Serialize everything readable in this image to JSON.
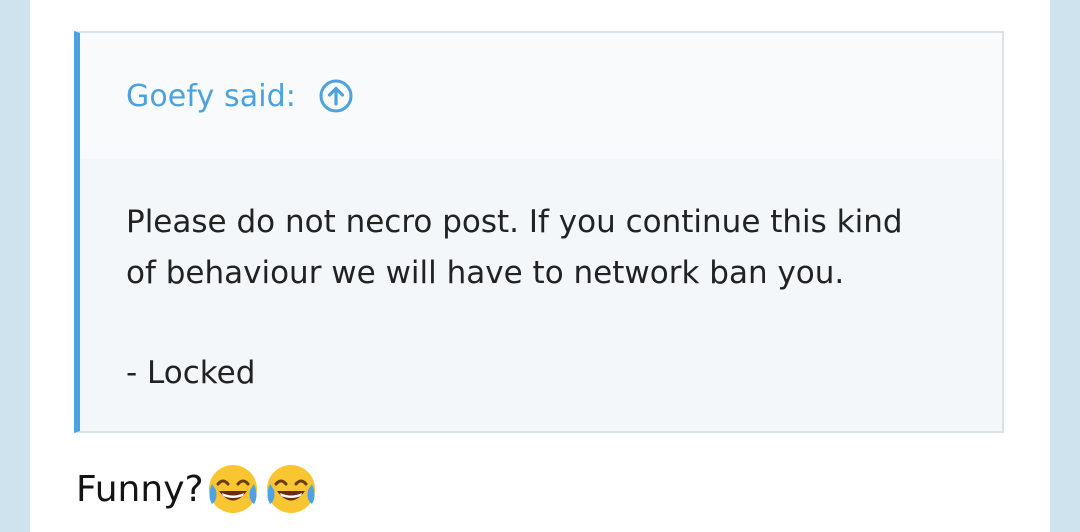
{
  "quote": {
    "author_label": "Goefy said:",
    "jump_icon": "arrow-up-circle-icon",
    "lines": [
      "Please do not necro post. If you continue this kind",
      "of behaviour we will have to network ban you."
    ],
    "signature": "- Locked"
  },
  "reply": {
    "text": "Funny?",
    "emojis": [
      "face-with-tears-of-joy",
      "face-with-tears-of-joy"
    ]
  },
  "colors": {
    "accent": "#4ba2de",
    "quote_bg": "#f4f7fa",
    "quote_header_bg": "#f8fafc",
    "page_bg": "#cfe3ef"
  }
}
